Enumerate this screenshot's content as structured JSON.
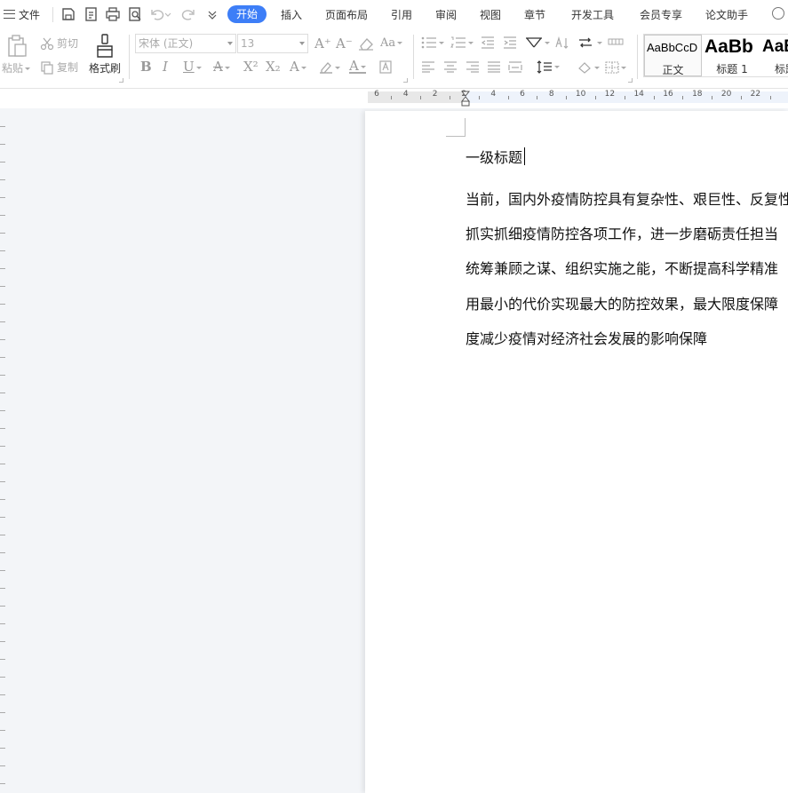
{
  "menubar": {
    "file_label": "文件",
    "tabs": [
      "开始",
      "插入",
      "页面布局",
      "引用",
      "审阅",
      "视图",
      "章节",
      "开发工具",
      "会员专享",
      "论文助手"
    ],
    "active_tab": "开始",
    "accent_color": "#3d7ef7"
  },
  "ribbon": {
    "paste_label": "粘贴",
    "cut_label": "剪切",
    "copy_label": "复制",
    "format_painter_label": "格式刷",
    "font_name": "宋体 (正文)",
    "font_size": "13",
    "styles": [
      {
        "sample": "AaBbCcD",
        "name": "正文"
      },
      {
        "sample": "AaBb",
        "name": "标题 1"
      },
      {
        "sample": "AaB",
        "name": "标题"
      }
    ]
  },
  "ruler": {
    "labels": [
      "6",
      "4",
      "2",
      "2",
      "4",
      "6",
      "8",
      "10",
      "12",
      "14",
      "16",
      "18",
      "20",
      "22"
    ]
  },
  "document": {
    "heading": "一级标题",
    "lines": [
      "当前，国内外疫情防控具有复杂性、艰巨性、反复性",
      "抓实抓细疫情防控各项工作，进一步磨砺责任担当",
      "统筹兼顾之谋、组织实施之能，不断提高科学精准",
      "用最小的代价实现最大的防控效果，最大限度保障",
      "度减少疫情对经济社会发展的影响保障"
    ]
  }
}
